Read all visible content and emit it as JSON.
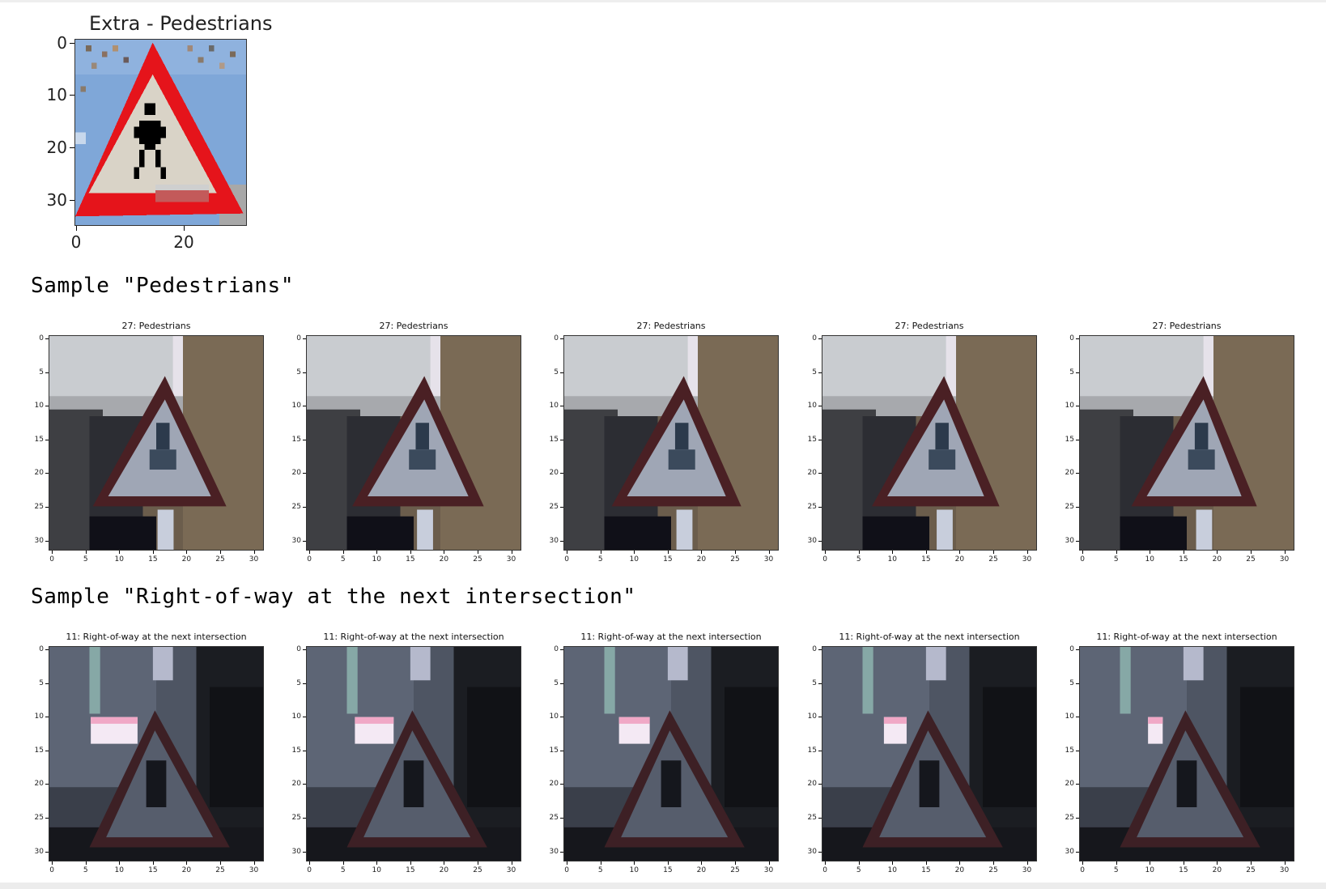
{
  "extra": {
    "title": "Extra - Pedestrians",
    "yticks": [
      "0",
      "10",
      "20",
      "30"
    ],
    "xticks": [
      "0",
      "20"
    ]
  },
  "section1": {
    "heading": "Sample \"Pedestrians\"",
    "title": "27: Pedestrians"
  },
  "section2": {
    "heading": "Sample \"Right-of-way at the next intersection\"",
    "title": "11: Right-of-way at the next intersection"
  },
  "small_ticks": [
    "0",
    "5",
    "10",
    "15",
    "20",
    "25",
    "30"
  ],
  "icons": {
    "pedestrian_sign": "pedestrian-warning-sign-image",
    "intersection_sign": "intersection-warning-sign-image"
  }
}
